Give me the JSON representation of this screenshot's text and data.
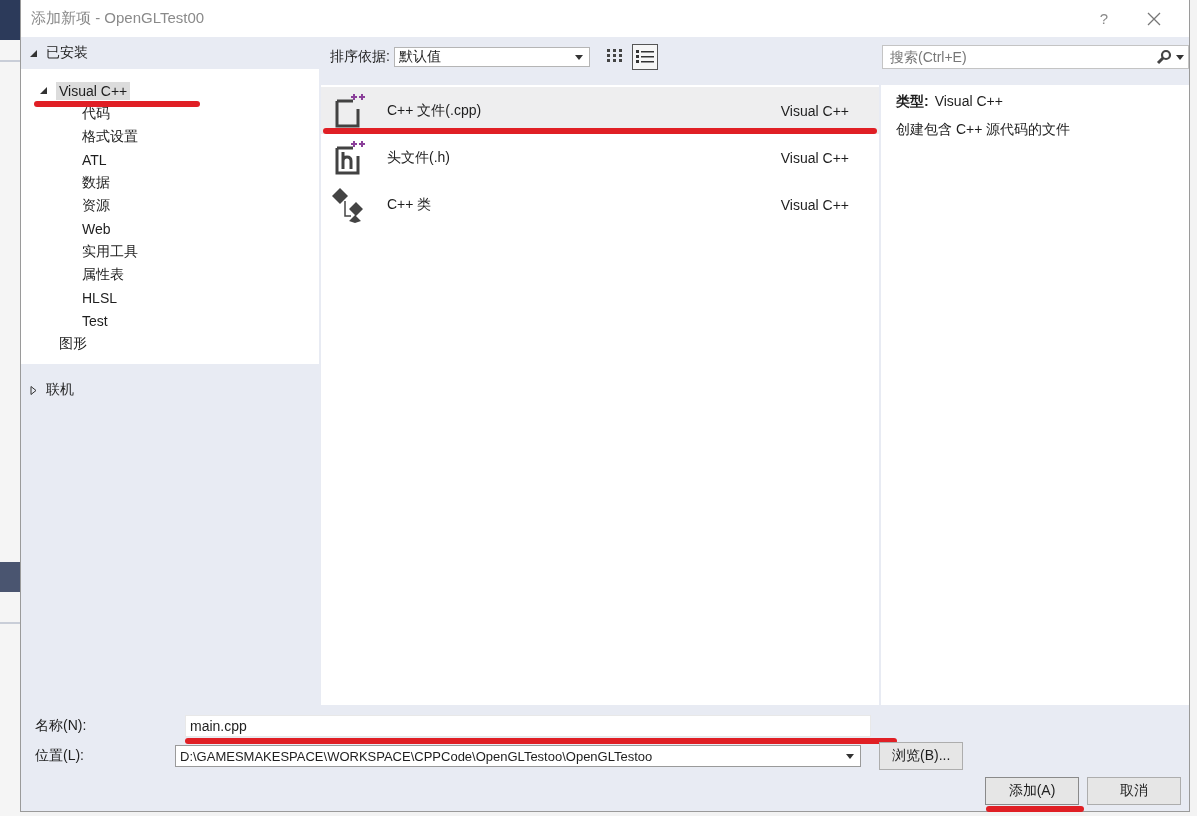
{
  "window": {
    "title": "添加新项 - OpenGLTest00",
    "help": "?"
  },
  "sidebar": {
    "sections": [
      {
        "label": "已安装",
        "expanded": true,
        "children": [
          {
            "label": "Visual C++",
            "expanded": true,
            "selected": true,
            "underlined": true,
            "children": [
              {
                "label": "代码",
                "selected": false
              },
              {
                "label": "格式设置",
                "selected": false
              },
              {
                "label": "ATL",
                "selected": false
              },
              {
                "label": "数据",
                "selected": false
              },
              {
                "label": "资源",
                "selected": false
              },
              {
                "label": "Web",
                "selected": false
              },
              {
                "label": "实用工具",
                "selected": false
              },
              {
                "label": "属性表",
                "selected": false
              },
              {
                "label": "HLSL",
                "selected": false
              },
              {
                "label": "Test",
                "selected": false
              }
            ]
          },
          {
            "label": "图形",
            "selected": false
          }
        ]
      },
      {
        "label": "联机",
        "expanded": false
      }
    ]
  },
  "toolbar": {
    "sort_label": "排序依据:",
    "sort_value": "默认值",
    "views": [
      {
        "kind": "grid",
        "selected": false
      },
      {
        "kind": "list",
        "selected": true
      }
    ],
    "search": {
      "placeholder": "搜索(Ctrl+E)"
    }
  },
  "templates": [
    {
      "kind": "cpp",
      "name": "C++ 文件(.cpp)",
      "category": "Visual C++",
      "selected": true,
      "underlined": true
    },
    {
      "kind": "header",
      "name": "头文件(.h)",
      "category": "Visual C++",
      "selected": false,
      "underlined": false
    },
    {
      "kind": "class",
      "name": "C++ 类",
      "category": "Visual C++",
      "selected": false,
      "underlined": false
    }
  ],
  "details": {
    "type_label": "类型:",
    "type_value": "Visual C++",
    "description": "创建包含 C++ 源代码的文件"
  },
  "form": {
    "name_label": "名称(N):",
    "name_value": "main.cpp",
    "name_underlined": true,
    "location_label": "位置(L):",
    "location_value": "D:\\GAMESMAKESPACE\\WORKSPACE\\CPPCode\\OpenGLTestoo\\OpenGLTestoo",
    "browse": "浏览(B)..."
  },
  "buttons": [
    {
      "label": "添加(A)",
      "kind": "primary",
      "underlined": true
    },
    {
      "label": "取消",
      "kind": "default",
      "underlined": false
    }
  ]
}
